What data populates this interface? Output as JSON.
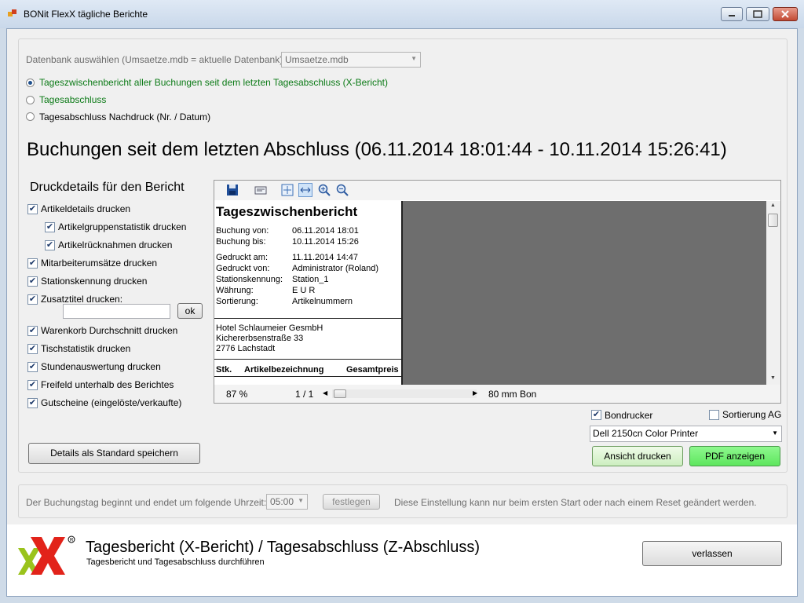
{
  "window": {
    "title": "BONit FlexX tägliche Berichte"
  },
  "db": {
    "label": "Datenbank auswählen (Umsaetze.mdb = aktuelle Datenbank):",
    "value": "Umsaetze.mdb"
  },
  "radios": [
    {
      "label": "Tageszwischenbericht aller Buchungen seit dem letzten Tagesabschluss (X-Bericht)",
      "selected": true
    },
    {
      "label": "Tagesabschluss",
      "selected": false
    },
    {
      "label": "Tagesabschluss Nachdruck (Nr. / Datum)",
      "selected": false
    }
  ],
  "heading": "Buchungen seit dem letzten Abschluss (06.11.2014 18:01:44 - 10.11.2014 15:26:41)",
  "details": {
    "title": "Druckdetails für den Bericht",
    "items": [
      "Artikeldetails drucken",
      "Artikelgruppenstatistik drucken",
      "Artikelrücknahmen drucken",
      "Mitarbeiterumsätze drucken",
      "Stationskennung drucken",
      "Zusatztitel drucken:",
      "Warenkorb Durchschnitt drucken",
      "Tischstatistik drucken",
      "Stundenauswertung drucken",
      "Freifeld unterhalb des Berichtes",
      "Gutscheine (eingelöste/verkaufte)"
    ],
    "zusatz_value": "",
    "ok_label": "ok",
    "save_label": "Details als Standard speichern"
  },
  "preview": {
    "report_title": "Tageszwischenbericht",
    "lines1": [
      [
        "Buchung  von:",
        "06.11.2014    18:01"
      ],
      [
        "Buchung  bis:",
        "10.11.2014    15:26"
      ]
    ],
    "lines2": [
      [
        "Gedruckt   am:",
        "11.11.2014    14:47"
      ],
      [
        "Gedruckt  von:",
        "Administrator    (Roland)"
      ],
      [
        "Stationskennung:",
        "Station_1"
      ],
      [
        "Währung:",
        "E U R"
      ],
      [
        "Sortierung:",
        "Artikelnummern"
      ]
    ],
    "address": [
      "Hotel   Schlaumeier   GesmbH",
      "Kichererbsenstraße   33",
      "2776   Lachstadt"
    ],
    "table_headers": [
      "Stk.",
      "Artikelbezeichnung",
      "Gesamtpreis"
    ],
    "zoom": "87 %",
    "page": "1 / 1",
    "paper_size": "80 mm Bon"
  },
  "printer": {
    "bondrucker_label": "Bondrucker",
    "bondrucker_checked": true,
    "sortierung_label": "Sortierung AG",
    "sortierung_checked": false,
    "selected_printer": "Dell 2150cn Color Printer",
    "print_label": "Ansicht drucken",
    "pdf_label": "PDF anzeigen"
  },
  "daystart": {
    "label": "Der Buchungstag beginnt und endet um folgende Uhrzeit:",
    "time": "05:00",
    "set_label": "festlegen",
    "note": "Diese Einstellung kann nur beim ersten Start oder nach einem Reset geändert werden."
  },
  "footer": {
    "title": "Tagesbericht (X-Bericht) / Tagesabschluss (Z-Abschluss)",
    "subtitle": "Tagesbericht und Tagesabschluss durchführen",
    "exit_label": "verlassen"
  }
}
